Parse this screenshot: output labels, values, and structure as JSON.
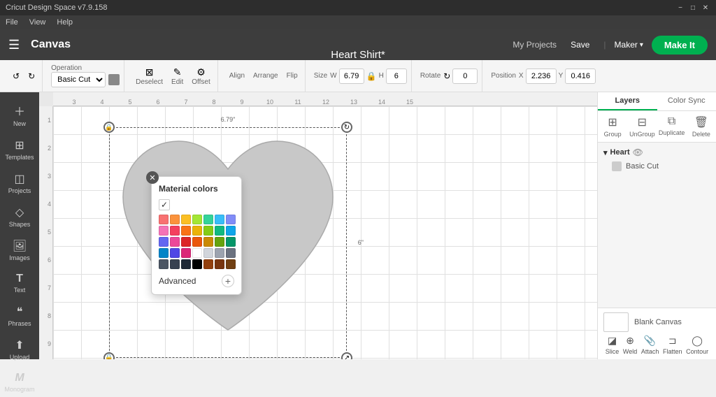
{
  "titleBar": {
    "title": "Cricut Design Space v7.9.158",
    "minimize": "−",
    "maximize": "□",
    "close": "✕"
  },
  "menuBar": {
    "items": [
      "File",
      "View",
      "Help"
    ]
  },
  "topNav": {
    "hamburger": "☰",
    "canvasLabel": "Canvas",
    "docTitle": "Heart Shirt*",
    "myProjects": "My Projects",
    "save": "Save",
    "separator": "|",
    "maker": "Maker",
    "makeIt": "Make It"
  },
  "toolbar": {
    "operation": "Operation",
    "operationValue": "Basic Cut",
    "deselect": "Deselect",
    "edit": "Edit",
    "offset": "Offset",
    "align": "Align",
    "arrange": "Arrange",
    "flip": "Flip",
    "size": "Size",
    "sizeW": "W",
    "sizeWValue": "6.79",
    "sizeH": "H",
    "sizeHValue": "6",
    "rotate": "Rotate",
    "rotateValue": "0",
    "position": "Position",
    "posX": "X",
    "posXValue": "2.236",
    "posY": "Y",
    "posYValue": "0.416",
    "undoLabel": "↺",
    "redoLabel": "↻"
  },
  "sidebar": {
    "items": [
      {
        "id": "new",
        "icon": "+",
        "label": "New"
      },
      {
        "id": "templates",
        "icon": "⊞",
        "label": "Templates"
      },
      {
        "id": "projects",
        "icon": "◫",
        "label": "Projects"
      },
      {
        "id": "shapes",
        "icon": "◇",
        "label": "Shapes"
      },
      {
        "id": "images",
        "icon": "🖼",
        "label": "Images"
      },
      {
        "id": "text",
        "icon": "T",
        "label": "Text"
      },
      {
        "id": "phrases",
        "icon": "❝",
        "label": "Phrases"
      },
      {
        "id": "upload",
        "icon": "⬆",
        "label": "Upload"
      },
      {
        "id": "monogram",
        "icon": "M",
        "label": "Monogram"
      }
    ]
  },
  "colorPicker": {
    "title": "Material colors",
    "checkmark": "✓",
    "advancedLabel": "Advanced",
    "plusLabel": "+",
    "colors": [
      "#f87171",
      "#fb923c",
      "#fbbf24",
      "#a3e635",
      "#34d399",
      "#38bdf8",
      "#818cf8",
      "#f472b6",
      "#f43f5e",
      "#f97316",
      "#eab308",
      "#84cc16",
      "#10b981",
      "#0ea5e9",
      "#6366f1",
      "#ec4899",
      "#dc2626",
      "#ea580c",
      "#ca8a04",
      "#65a30d",
      "#059669",
      "#0284c7",
      "#4f46e5",
      "#db2777",
      "#ffffff",
      "#d1d5db",
      "#9ca3af",
      "#6b7280",
      "#4b5563",
      "#374151",
      "#1f2937",
      "#000000",
      "#92400e",
      "#78350f",
      "#713f12"
    ]
  },
  "rightPanel": {
    "tabs": [
      "Layers",
      "Color Sync"
    ],
    "activeTab": "Layers",
    "actions": [
      {
        "id": "group",
        "icon": "⊞",
        "label": "Group",
        "disabled": false
      },
      {
        "id": "ungroup",
        "icon": "⊟",
        "label": "UnGroup",
        "disabled": false
      },
      {
        "id": "duplicate",
        "icon": "⧉",
        "label": "Duplicate",
        "disabled": false
      },
      {
        "id": "delete",
        "icon": "🗑",
        "label": "Delete",
        "disabled": false
      }
    ],
    "layerGroups": [
      {
        "name": "Heart",
        "expanded": true,
        "items": [
          {
            "label": "Basic Cut",
            "color": "#cccccc"
          }
        ]
      }
    ]
  },
  "bottomPanel": {
    "blankCanvasLabel": "Blank Canvas",
    "actions": [
      {
        "id": "slice",
        "icon": "◪",
        "label": "Slice"
      },
      {
        "id": "weld",
        "icon": "⊕",
        "label": "Weld"
      },
      {
        "id": "attach",
        "icon": "📎",
        "label": "Attach"
      },
      {
        "id": "flatten",
        "icon": "⊐",
        "label": "Flatten"
      },
      {
        "id": "contour",
        "icon": "◯",
        "label": "Contour"
      }
    ]
  },
  "ruler": {
    "topMarks": [
      "3",
      "4",
      "5",
      "6",
      "7",
      "8",
      "9",
      "10",
      "11",
      "12",
      "13",
      "14",
      "15"
    ],
    "leftMarks": [
      "1",
      "2",
      "3",
      "4",
      "5",
      "6",
      "7",
      "8",
      "9"
    ]
  }
}
